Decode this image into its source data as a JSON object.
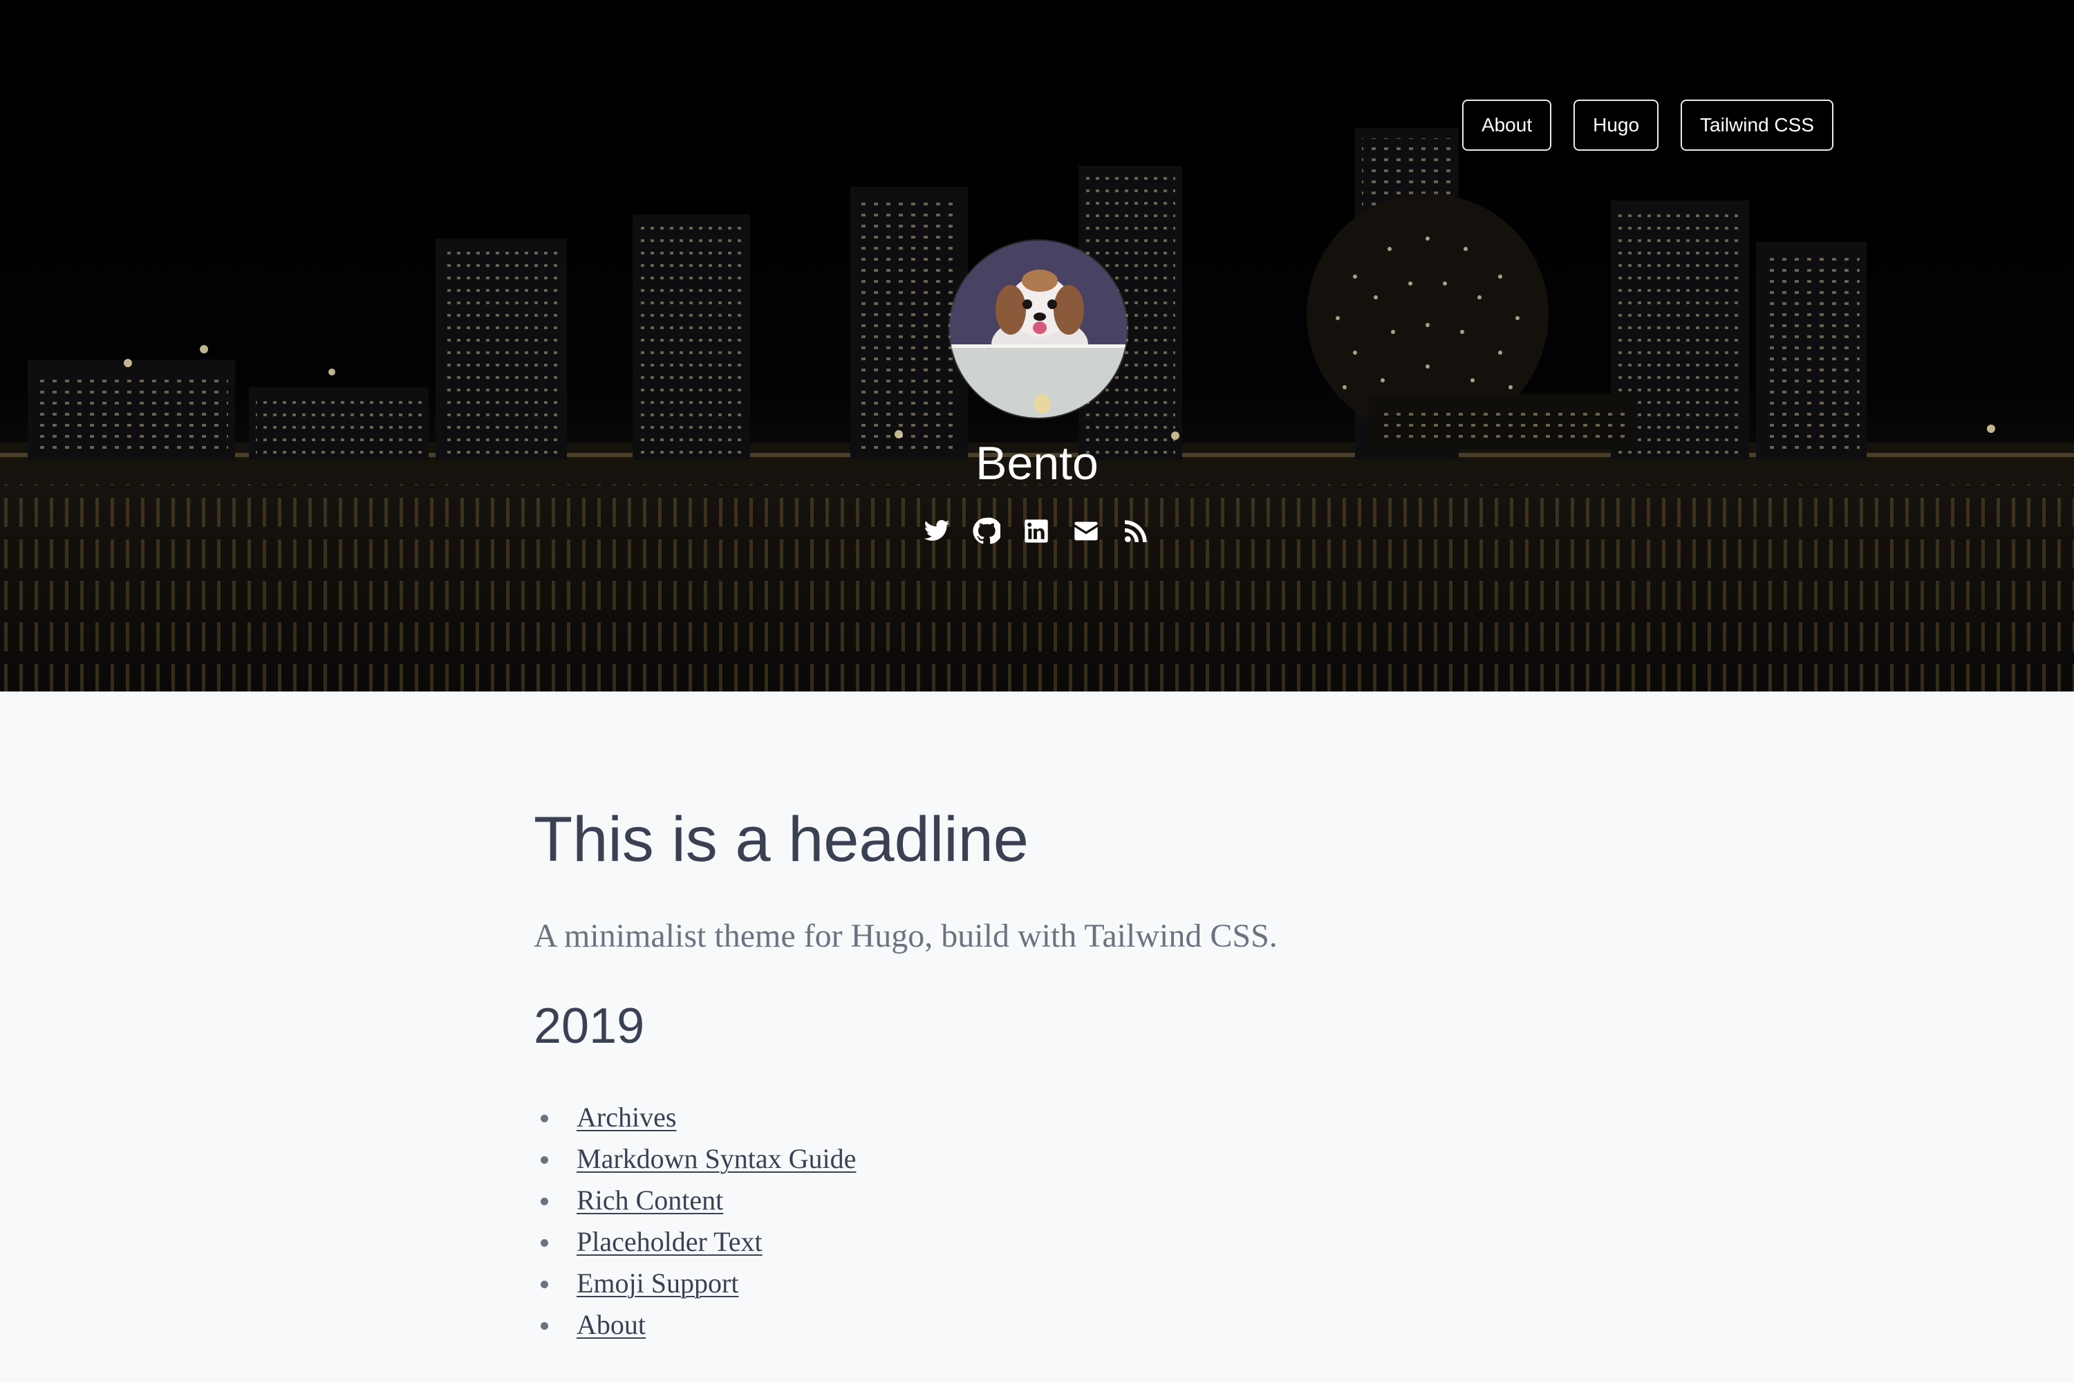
{
  "nav": {
    "items": [
      {
        "label": "About"
      },
      {
        "label": "Hugo"
      },
      {
        "label": "Tailwind CSS"
      }
    ]
  },
  "header": {
    "site_title": "Bento",
    "avatar_icon": "dog-avatar",
    "socials": [
      {
        "icon": "twitter-icon"
      },
      {
        "icon": "github-icon"
      },
      {
        "icon": "linkedin-icon"
      },
      {
        "icon": "email-icon"
      },
      {
        "icon": "rss-icon"
      }
    ]
  },
  "main": {
    "headline": "This is a headline",
    "tagline": "A minimalist theme for Hugo, build with Tailwind CSS.",
    "year": "2019",
    "posts": [
      {
        "title": "Archives"
      },
      {
        "title": "Markdown Syntax Guide"
      },
      {
        "title": "Rich Content"
      },
      {
        "title": "Placeholder Text"
      },
      {
        "title": "Emoji Support"
      },
      {
        "title": "About"
      }
    ]
  },
  "colors": {
    "hero_bg": "#000000",
    "page_bg": "#f8f9fb",
    "heading_text": "#3a4152",
    "muted_text": "#6b7280"
  }
}
